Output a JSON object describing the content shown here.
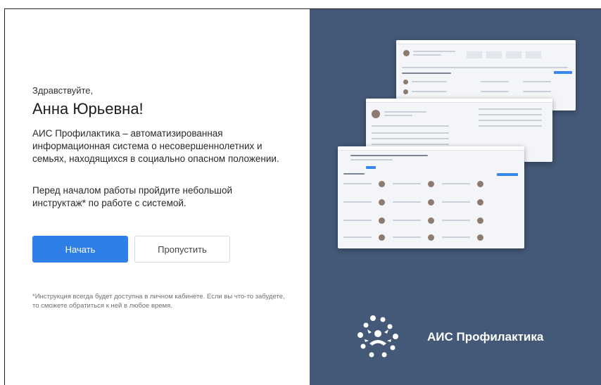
{
  "greeting": "Здравствуйте,",
  "user_name": "Анна Юрьевна!",
  "description": "АИС Профилактика – автоматизированная информационная система о несовершеннолетних и семьях, находящихся в социально опасном положении.",
  "instruction_prompt": "Перед началом работы пройдите небольшой инструктаж* по работе с системой.",
  "buttons": {
    "start": "Начать",
    "skip": "Пропустить"
  },
  "footnote": "*Инструкция всегда будет доступна в личном кабинете. Если вы что-то забудете, то сможете обратиться к ней в любое время.",
  "brand": {
    "name": "АИС Профилактика"
  },
  "colors": {
    "accent": "#2e7fe8",
    "panel": "#445877"
  }
}
